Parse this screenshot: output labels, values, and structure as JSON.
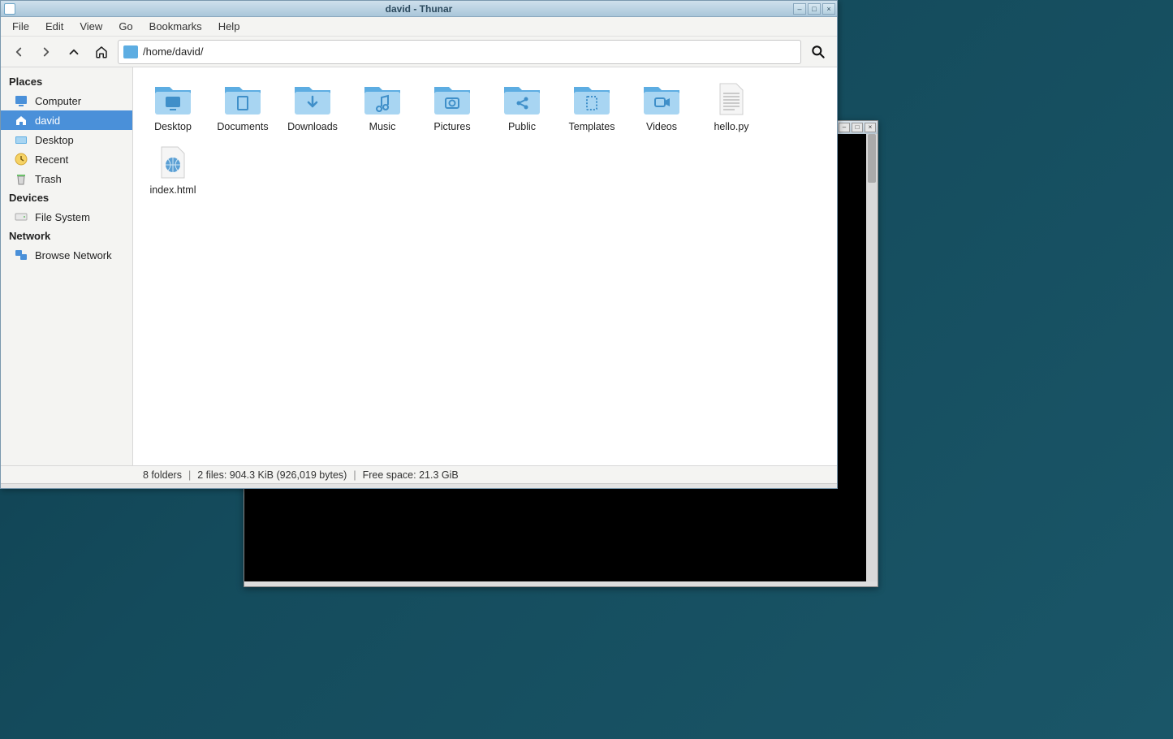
{
  "window": {
    "title": "david - Thunar"
  },
  "menubar": [
    "File",
    "Edit",
    "View",
    "Go",
    "Bookmarks",
    "Help"
  ],
  "path": "/home/david/",
  "sidebar": {
    "sections": [
      {
        "header": "Places",
        "items": [
          {
            "label": "Computer",
            "icon": "monitor",
            "selected": false
          },
          {
            "label": "david",
            "icon": "home",
            "selected": true
          },
          {
            "label": "Desktop",
            "icon": "desktop",
            "selected": false
          },
          {
            "label": "Recent",
            "icon": "clock",
            "selected": false
          },
          {
            "label": "Trash",
            "icon": "trash",
            "selected": false
          }
        ]
      },
      {
        "header": "Devices",
        "items": [
          {
            "label": "File System",
            "icon": "drive",
            "selected": false
          }
        ]
      },
      {
        "header": "Network",
        "items": [
          {
            "label": "Browse Network",
            "icon": "network",
            "selected": false
          }
        ]
      }
    ]
  },
  "files": [
    {
      "label": "Desktop",
      "type": "folder",
      "glyph": "desktop"
    },
    {
      "label": "Documents",
      "type": "folder",
      "glyph": "document"
    },
    {
      "label": "Downloads",
      "type": "folder",
      "glyph": "download"
    },
    {
      "label": "Music",
      "type": "folder",
      "glyph": "music"
    },
    {
      "label": "Pictures",
      "type": "folder",
      "glyph": "camera"
    },
    {
      "label": "Public",
      "type": "folder",
      "glyph": "share"
    },
    {
      "label": "Templates",
      "type": "folder",
      "glyph": "template"
    },
    {
      "label": "Videos",
      "type": "folder",
      "glyph": "video"
    },
    {
      "label": "hello.py",
      "type": "text",
      "glyph": "text"
    },
    {
      "label": "index.html",
      "type": "html",
      "glyph": "globe"
    }
  ],
  "status": {
    "folders": "8 folders",
    "files": "2 files: 904.3 KiB (926,019 bytes)",
    "freespace": "Free space: 21.3 GiB"
  }
}
